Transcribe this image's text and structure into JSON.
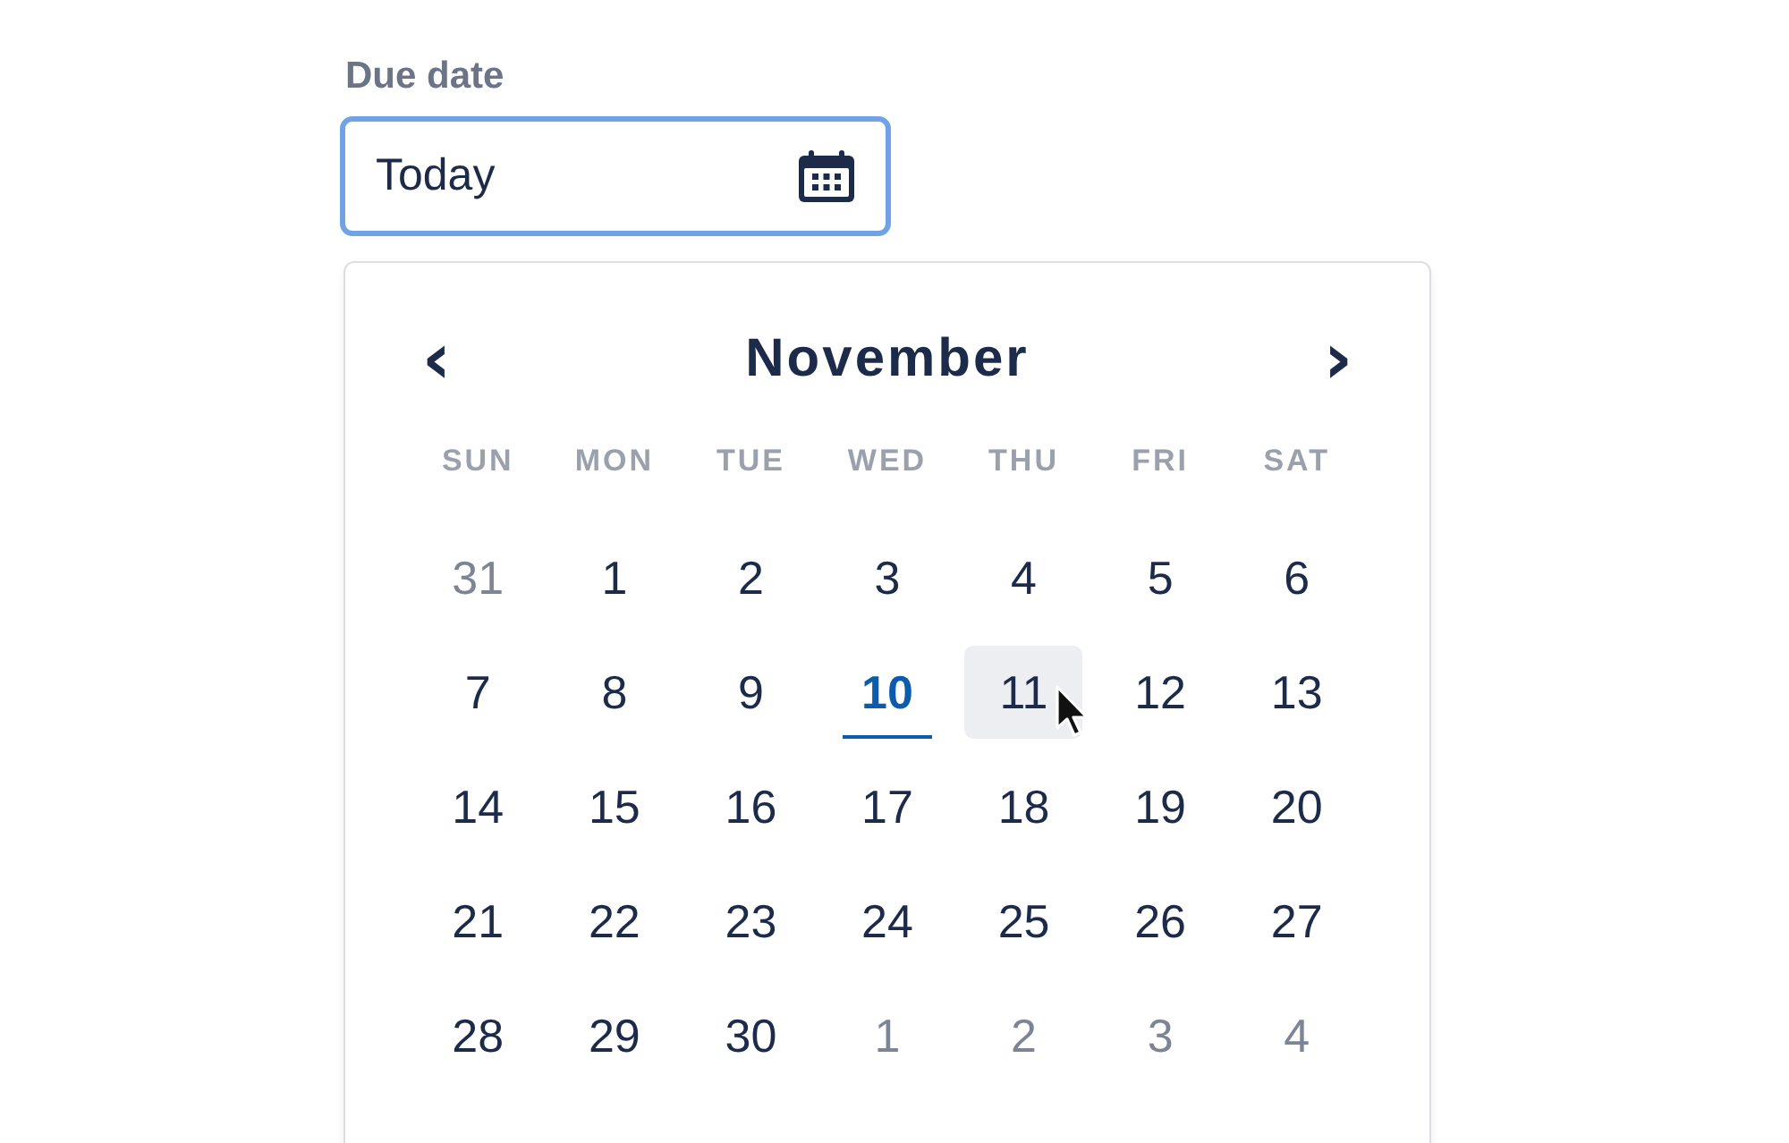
{
  "field": {
    "label": "Due date",
    "value": "Today",
    "focused": true
  },
  "calendar": {
    "month": "November",
    "prev": "‹",
    "next": "›",
    "weekdays": [
      "SUN",
      "MON",
      "TUE",
      "WED",
      "THU",
      "FRI",
      "SAT"
    ],
    "weeks": [
      [
        {
          "day": "31",
          "outside": true,
          "today": false,
          "hovered": false
        },
        {
          "day": "1",
          "outside": false,
          "today": false,
          "hovered": false
        },
        {
          "day": "2",
          "outside": false,
          "today": false,
          "hovered": false
        },
        {
          "day": "3",
          "outside": false,
          "today": false,
          "hovered": false
        },
        {
          "day": "4",
          "outside": false,
          "today": false,
          "hovered": false
        },
        {
          "day": "5",
          "outside": false,
          "today": false,
          "hovered": false
        },
        {
          "day": "6",
          "outside": false,
          "today": false,
          "hovered": false
        }
      ],
      [
        {
          "day": "7",
          "outside": false,
          "today": false,
          "hovered": false
        },
        {
          "day": "8",
          "outside": false,
          "today": false,
          "hovered": false
        },
        {
          "day": "9",
          "outside": false,
          "today": false,
          "hovered": false
        },
        {
          "day": "10",
          "outside": false,
          "today": true,
          "hovered": false
        },
        {
          "day": "11",
          "outside": false,
          "today": false,
          "hovered": true
        },
        {
          "day": "12",
          "outside": false,
          "today": false,
          "hovered": false
        },
        {
          "day": "13",
          "outside": false,
          "today": false,
          "hovered": false
        }
      ],
      [
        {
          "day": "14",
          "outside": false,
          "today": false,
          "hovered": false
        },
        {
          "day": "15",
          "outside": false,
          "today": false,
          "hovered": false
        },
        {
          "day": "16",
          "outside": false,
          "today": false,
          "hovered": false
        },
        {
          "day": "17",
          "outside": false,
          "today": false,
          "hovered": false
        },
        {
          "day": "18",
          "outside": false,
          "today": false,
          "hovered": false
        },
        {
          "day": "19",
          "outside": false,
          "today": false,
          "hovered": false
        },
        {
          "day": "20",
          "outside": false,
          "today": false,
          "hovered": false
        }
      ],
      [
        {
          "day": "21",
          "outside": false,
          "today": false,
          "hovered": false
        },
        {
          "day": "22",
          "outside": false,
          "today": false,
          "hovered": false
        },
        {
          "day": "23",
          "outside": false,
          "today": false,
          "hovered": false
        },
        {
          "day": "24",
          "outside": false,
          "today": false,
          "hovered": false
        },
        {
          "day": "25",
          "outside": false,
          "today": false,
          "hovered": false
        },
        {
          "day": "26",
          "outside": false,
          "today": false,
          "hovered": false
        },
        {
          "day": "27",
          "outside": false,
          "today": false,
          "hovered": false
        }
      ],
      [
        {
          "day": "28",
          "outside": false,
          "today": false,
          "hovered": false
        },
        {
          "day": "29",
          "outside": false,
          "today": false,
          "hovered": false
        },
        {
          "day": "30",
          "outside": false,
          "today": false,
          "hovered": false
        },
        {
          "day": "1",
          "outside": true,
          "today": false,
          "hovered": false
        },
        {
          "day": "2",
          "outside": true,
          "today": false,
          "hovered": false
        },
        {
          "day": "3",
          "outside": true,
          "today": false,
          "hovered": false
        },
        {
          "day": "4",
          "outside": true,
          "today": false,
          "hovered": false
        }
      ]
    ]
  }
}
